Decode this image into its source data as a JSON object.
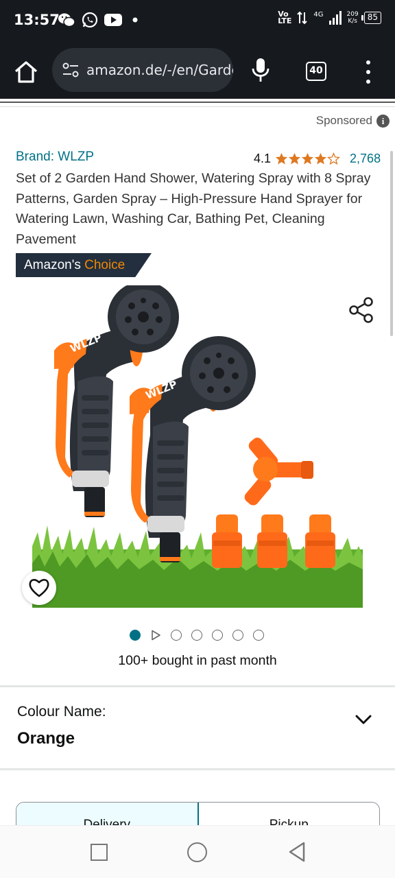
{
  "status_bar": {
    "time": "13:57",
    "volte_top": "Vo",
    "volte_bottom": "LTE",
    "network": "4G",
    "speed_top": "209",
    "speed_bottom": "K/s",
    "battery": "85",
    "icons": [
      "wechat-icon",
      "whatsapp-icon",
      "youtube-icon",
      "notification-dot-icon"
    ]
  },
  "browser": {
    "url": "amazon.de/-/en/Garden-Hand-Shower",
    "tab_count": "40"
  },
  "sponsored_label": "Sponsored",
  "product": {
    "brand": "Brand: WLZP",
    "rating": "4.1",
    "rating_stars": 4.1,
    "rating_count": "2,768",
    "title": "Set of 2 Garden Hand Shower, Watering Spray with 8 Spray Patterns, Garden Spray – High-Pressure Hand Sprayer for Watering Lawn, Washing Car, Bathing Pet, Cleaning Pavement",
    "badge_prefix": "Amazon's",
    "badge_suffix": "Choice",
    "image_brand_text": "WLZP",
    "image_count": 7,
    "active_image": 1,
    "bought": "100+ bought in past month"
  },
  "variation": {
    "label": "Colour Name:",
    "value": "Orange"
  },
  "fulfilment_tabs": [
    "Delivery",
    "Pickup"
  ],
  "colors": {
    "link": "#007185",
    "badge_bg": "#232f3e",
    "badge_accent": "#f08804",
    "star": "#de7921",
    "chrome_bg": "#16191e"
  }
}
